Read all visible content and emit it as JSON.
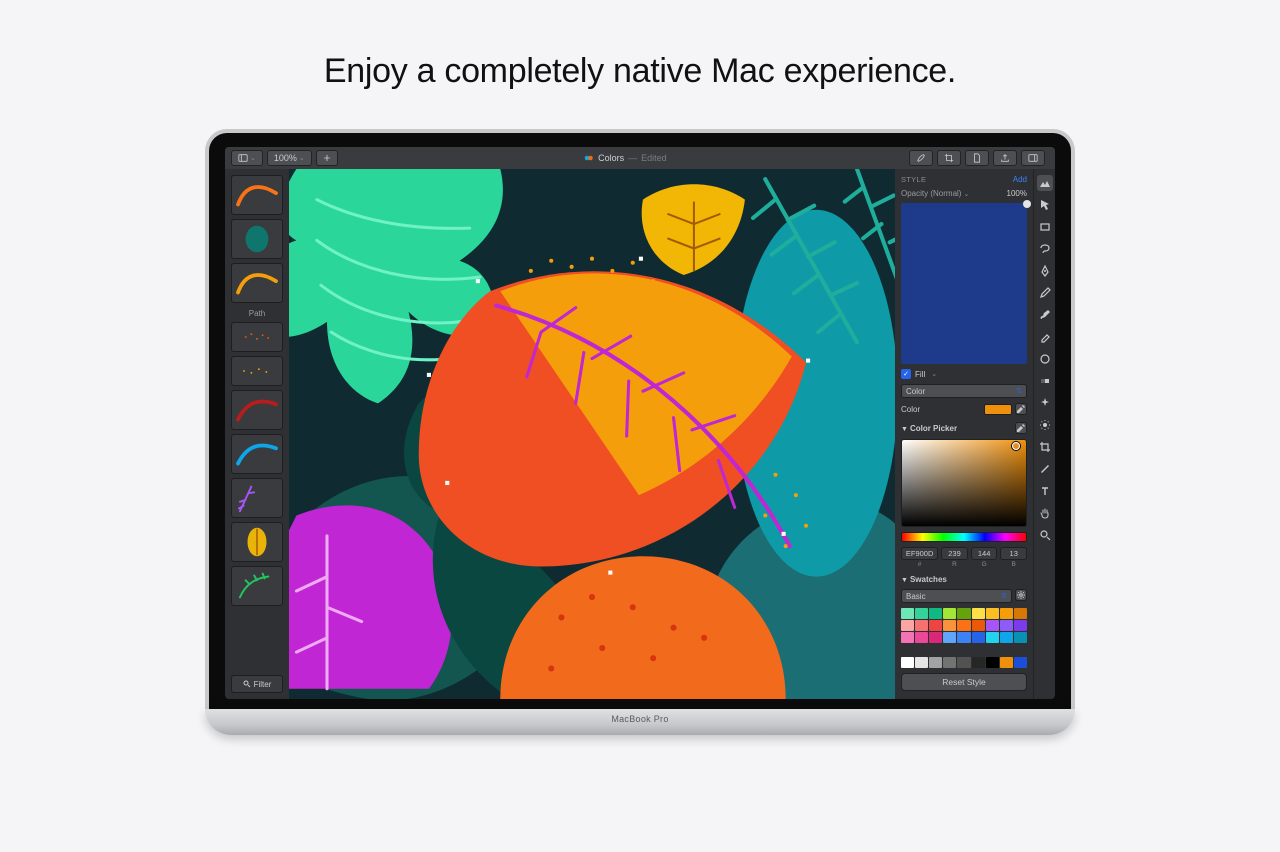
{
  "headline": "Enjoy a completely native Mac experience.",
  "device_label": "MacBook Pro",
  "toolbar": {
    "zoom": "100%",
    "title_doc": "Colors",
    "title_state": "Edited"
  },
  "thumbs": {
    "section_label": "Path",
    "filter_label": "Filter"
  },
  "inspector": {
    "style_heading": "STYLE",
    "add_label": "Add",
    "opacity_label": "Opacity (Normal)",
    "opacity_value": "100%",
    "fill_label": "Fill",
    "fill_type_label": "Color",
    "color_label": "Color",
    "selected_color": "#EF900D",
    "picker_heading": "Color Picker",
    "hex": "EF900D",
    "r": "239",
    "g": "144",
    "b": "13",
    "hex_lbl": "#",
    "r_lbl": "R",
    "g_lbl": "G",
    "b_lbl": "B",
    "swatches_heading": "Swatches",
    "swatches_set": "Basic",
    "reset_label": "Reset Style",
    "swatch_colors_main": [
      "#6ee7b7",
      "#34d399",
      "#10b981",
      "#a3e635",
      "#65a30d",
      "#fde047",
      "#fbbf24",
      "#f59e0b",
      "#d97706",
      "#fca5a5",
      "#f87171",
      "#ef4444",
      "#fb923c",
      "#f97316",
      "#ea580c",
      "#a855f7",
      "#8b5cf6",
      "#7c3aed",
      "#f472b6",
      "#ec4899",
      "#db2777",
      "#60a5fa",
      "#3b82f6",
      "#2563eb",
      "#22d3ee",
      "#0ea5e9",
      "#0891b2"
    ],
    "swatch_colors_gray": [
      "#ffffff",
      "#e5e5e5",
      "#a3a3a3",
      "#737373",
      "#525252",
      "#262626",
      "#000000",
      "#ef900d",
      "#1d4ed8"
    ]
  }
}
